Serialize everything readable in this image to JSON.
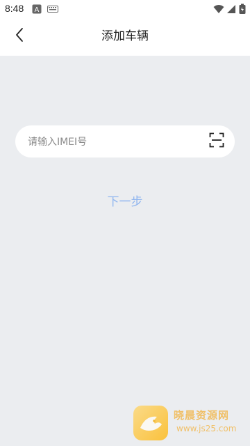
{
  "status_bar": {
    "time": "8:48",
    "icons": [
      "a-notification-icon",
      "keyboard-icon",
      "wifi-icon",
      "signal-icon",
      "battery-icon"
    ]
  },
  "header": {
    "title": "添加车辆",
    "back_icon": "chevron-left-icon"
  },
  "imei_input": {
    "placeholder": "请输入IMEI号",
    "value": "",
    "scan_icon": "scan-icon"
  },
  "actions": {
    "next_label": "下一步"
  },
  "watermark": {
    "title": "晓晨资源网",
    "url": "www.js25.com"
  },
  "colors": {
    "background": "#ebedf0",
    "header_bg": "#ffffff",
    "input_bg": "#ffffff",
    "next_link": "#8fb5ef",
    "watermark": "#f2b13b"
  }
}
